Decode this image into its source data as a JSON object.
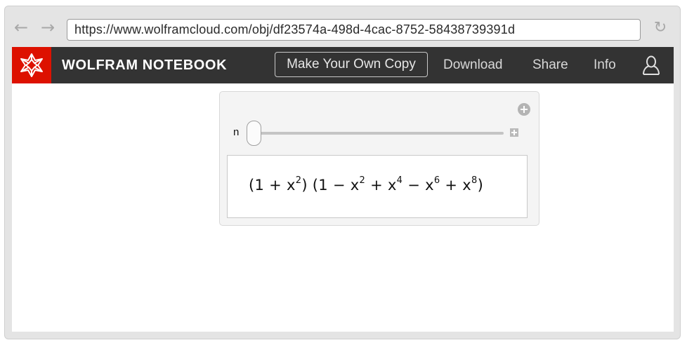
{
  "browser": {
    "back_icon": "←",
    "forward_icon": "→",
    "url": "https://www.wolframcloud.com/obj/df23574a-498d-4cac-8752-58438739391d",
    "reload_icon": "↻"
  },
  "header": {
    "logo_icon": "wolfram-spikey-icon",
    "brand": "WOLFRAM NOTEBOOK",
    "copy_button": "Make Your Own Copy",
    "download": "Download",
    "share": "Share",
    "info": "Info",
    "user_icon": "user-icon"
  },
  "manipulate": {
    "variable": "n",
    "slider_value": 0,
    "formula": {
      "p1": "(1 + x",
      "e1": "2",
      "p2": ") (1 − x",
      "e2": "2",
      "p3": " + x",
      "e3": "4",
      "p4": " − x",
      "e4": "6",
      "p5": " + x",
      "e5": "8",
      "p6": ")"
    }
  },
  "colors": {
    "brand_red": "#dd1100",
    "topbar": "#333333"
  }
}
